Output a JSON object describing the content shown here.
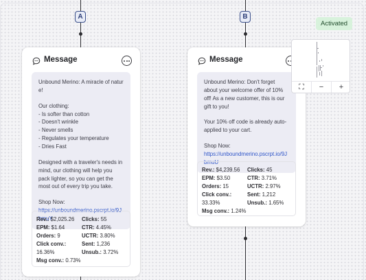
{
  "status": {
    "label": "Activated",
    "color": "#d8f2dc"
  },
  "branches": [
    {
      "badge": "A",
      "card": {
        "title": "Message",
        "icon": "message-bubble-icon",
        "body_lines": [
          "Unbound Merino: A miracle of nature!",
          "",
          "Our clothing:",
          "- Is softer than cotton",
          "- Doesn't wrinkle",
          "- Never smells",
          "- Regulates your temperature",
          "- Dries Fast",
          "",
          "Designed with a traveler's needs in mind, our clothing will help you pack lighter, so you can get the most out of every trip you take.",
          "",
          "Shop Now:"
        ],
        "link": "https://unboundmerino.pscrpt.io/9JbmuY",
        "stats": {
          "revenue": {
            "label": "Rev.:",
            "value": "$2,025.26"
          },
          "epm": {
            "label": "EPM:",
            "value": "$1.64"
          },
          "orders": {
            "label": "Orders:",
            "value": "9"
          },
          "click_conv": {
            "label": "Click conv.:",
            "value": "16.36%"
          },
          "msg_conv": {
            "label": "Msg conv.:",
            "value": "0.73%"
          },
          "clicks": {
            "label": "Clicks:",
            "value": "55"
          },
          "ctr": {
            "label": "CTR:",
            "value": "4.45%"
          },
          "uctr": {
            "label": "UCTR:",
            "value": "3.80%"
          },
          "sent": {
            "label": "Sent:",
            "value": "1,236"
          },
          "unsub": {
            "label": "Unsub.:",
            "value": "3.72%"
          }
        }
      }
    },
    {
      "badge": "B",
      "card": {
        "title": "Message",
        "icon": "message-bubble-icon",
        "body_lines": [
          "Unbound Merino: Don't forget about your welcome offer of 10% off! As a new customer, this is our gift to you!",
          "",
          "Your 10% off code is already auto-applied to your cart.",
          "",
          "Shop Now:"
        ],
        "link": "https://unboundmerino.pscrpt.io/9JbmuU",
        "stats": {
          "revenue": {
            "label": "Rev.:",
            "value": "$4,239.56"
          },
          "epm": {
            "label": "EPM:",
            "value": "$3.50"
          },
          "orders": {
            "label": "Orders:",
            "value": "15"
          },
          "click_conv": {
            "label": "Click conv.:",
            "value": "33.33%"
          },
          "msg_conv": {
            "label": "Msg conv.:",
            "value": "1.24%"
          },
          "clicks": {
            "label": "Clicks:",
            "value": "45"
          },
          "ctr": {
            "label": "CTR:",
            "value": "3.71%"
          },
          "uctr": {
            "label": "UCTR:",
            "value": "2.97%"
          },
          "sent": {
            "label": "Sent:",
            "value": "1,212"
          },
          "unsub": {
            "label": "Unsub.:",
            "value": "1.65%"
          }
        }
      }
    }
  ],
  "minimap": {
    "controls": [
      {
        "name": "fit-view-icon",
        "symbol": "⛶"
      },
      {
        "name": "zoom-out-icon",
        "symbol": "−"
      },
      {
        "name": "zoom-in-icon",
        "symbol": "+"
      }
    ]
  }
}
